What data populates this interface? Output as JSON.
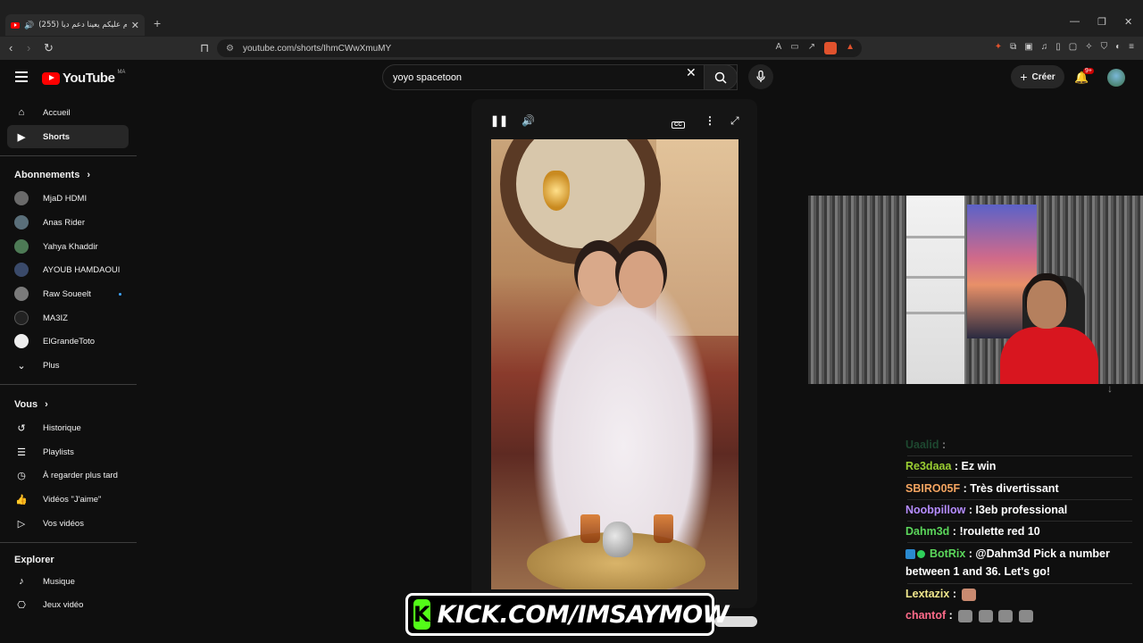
{
  "browser": {
    "tab_title": "(255) سلام عليكم يعينا دعم ديا",
    "new_tab": "+",
    "url": "youtube.com/shorts/IhmCWwXmuMY"
  },
  "header": {
    "logo_text": "YouTube",
    "logo_country": "MA",
    "search_value": "yoyo spacetoon",
    "create_label": "Créer",
    "notif_count": "9+"
  },
  "sidebar": {
    "main": [
      {
        "label": "Accueil",
        "icon": "home-icon"
      },
      {
        "label": "Shorts",
        "icon": "shorts-icon"
      }
    ],
    "subscriptions_title": "Abonnements",
    "subscriptions": [
      {
        "label": "MjaD HDMI"
      },
      {
        "label": "Anas Rider"
      },
      {
        "label": "Yahya Khaddir"
      },
      {
        "label": "AYOUB HAMDAOUI"
      },
      {
        "label": "Raw Soueelt"
      },
      {
        "label": "MA3IZ"
      },
      {
        "label": "ElGrandeToto"
      },
      {
        "label": "Plus"
      }
    ],
    "you_title": "Vous",
    "you": [
      {
        "label": "Historique",
        "icon": "history-icon"
      },
      {
        "label": "Playlists",
        "icon": "playlist-icon"
      },
      {
        "label": "À regarder plus tard",
        "icon": "clock-icon"
      },
      {
        "label": "Vidéos \"J'aime\"",
        "icon": "thumbs-up-icon"
      },
      {
        "label": "Vos vidéos",
        "icon": "video-icon"
      }
    ],
    "explore_title": "Explorer",
    "explore": [
      {
        "label": "Musique",
        "icon": "music-icon"
      },
      {
        "label": "Jeux vidéo",
        "icon": "gaming-icon"
      }
    ]
  },
  "chat": [
    {
      "user": "Uaalid",
      "color": "#2e8b57",
      "msg": ""
    },
    {
      "user": "Re3daaa",
      "color": "#9acd32",
      "msg": "Ez win"
    },
    {
      "user": "SBIRO05F",
      "color": "#f4a460",
      "msg": "Très divertissant"
    },
    {
      "user": "Noobpillow",
      "color": "#b58cff",
      "msg": "I3eb professional"
    },
    {
      "user": "Dahm3d",
      "color": "#5bd65b",
      "msg": "!roulette red 10"
    },
    {
      "user": "BotRix",
      "color": "#5bd65b",
      "msg": "@Dahm3d Pick a number between 1 and 36. Let's go!"
    },
    {
      "user": "Lextazix",
      "color": "#f0e68c",
      "msg": ""
    },
    {
      "user": "chantof",
      "color": "#ff6b8a",
      "msg": ""
    }
  ],
  "banner": {
    "k": "K",
    "text": "KICK.COM/IMSAYMOW"
  }
}
